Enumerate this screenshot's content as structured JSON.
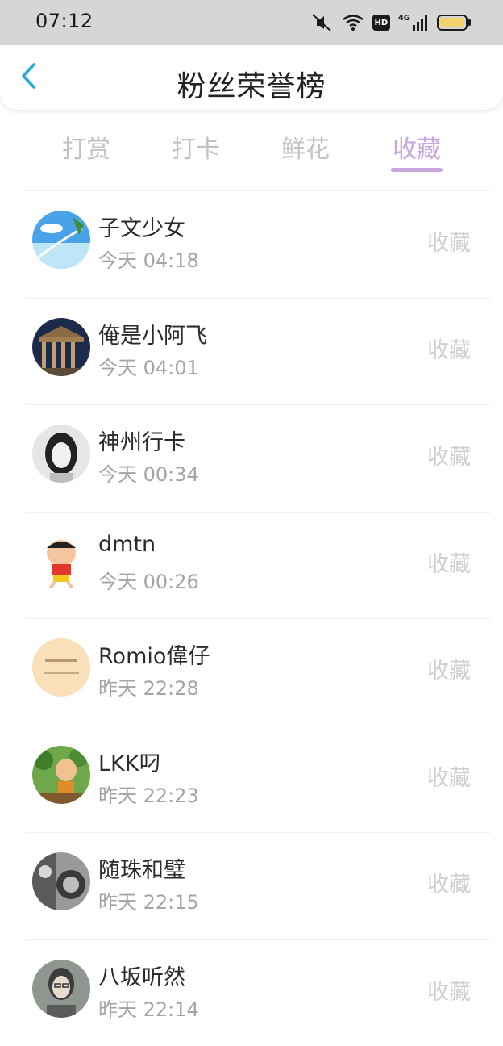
{
  "status_bar": {
    "time": "07:12",
    "icons": [
      "mute-icon",
      "wifi-icon",
      "hd-icon",
      "signal-4g-icon",
      "battery-icon"
    ],
    "hd_label": "HD",
    "network_label": "4G"
  },
  "header": {
    "title": "粉丝荣誉榜",
    "back_icon": "chevron-left-icon",
    "accent_color": "#2aa6e0"
  },
  "tabs": [
    {
      "label": "打赏",
      "active": false
    },
    {
      "label": "打卡",
      "active": false
    },
    {
      "label": "鲜花",
      "active": false
    },
    {
      "label": "收藏",
      "active": true
    }
  ],
  "active_tab_color": "#c9a6e0",
  "fans": [
    {
      "name": "子文少女",
      "time": "今天 04:18",
      "action": "收藏"
    },
    {
      "name": "俺是小阿飞",
      "time": "今天 04:01",
      "action": "收藏"
    },
    {
      "name": "神州行卡",
      "time": "今天 00:34",
      "action": "收藏"
    },
    {
      "name": "dmtn",
      "time": "今天 00:26",
      "action": "收藏"
    },
    {
      "name": "Romio偉仔",
      "time": "昨天 22:28",
      "action": "收藏"
    },
    {
      "name": "LKK叼",
      "time": "昨天 22:23",
      "action": "收藏"
    },
    {
      "name": "随珠和璧",
      "time": "昨天 22:15",
      "action": "收藏"
    },
    {
      "name": "八坂听然",
      "time": "昨天 22:14",
      "action": "收藏"
    }
  ]
}
